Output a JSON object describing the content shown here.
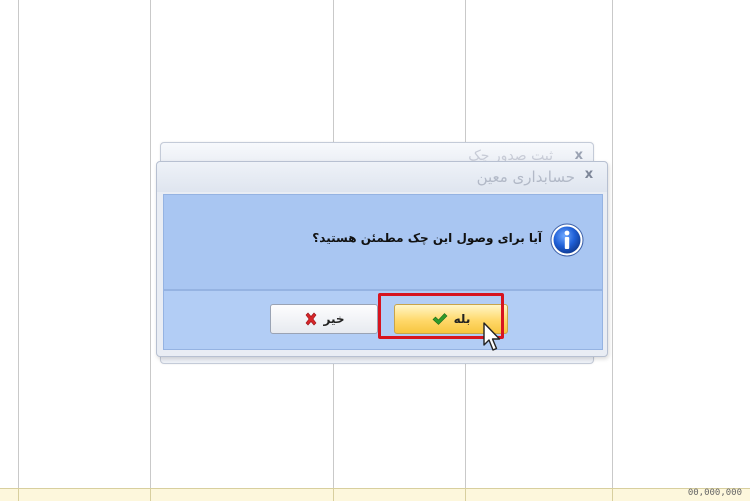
{
  "background": {
    "footer_value": "00,000,000"
  },
  "back_dialog": {
    "title": "ثبت صدور چک",
    "close_glyph": "x"
  },
  "dialog": {
    "title": "حسابداری معین",
    "close_glyph": "x",
    "icon": "info-icon",
    "message": "آیا برای وصول این چک مطمئن هستید؟",
    "buttons": {
      "yes_label": "بله",
      "yes_icon": "check-icon",
      "no_label": "خیر",
      "no_icon": "cross-icon"
    }
  },
  "colors": {
    "content_bg": "#a9c6f2",
    "yes_button": "#ffd86a",
    "highlight": "#d7141f"
  }
}
